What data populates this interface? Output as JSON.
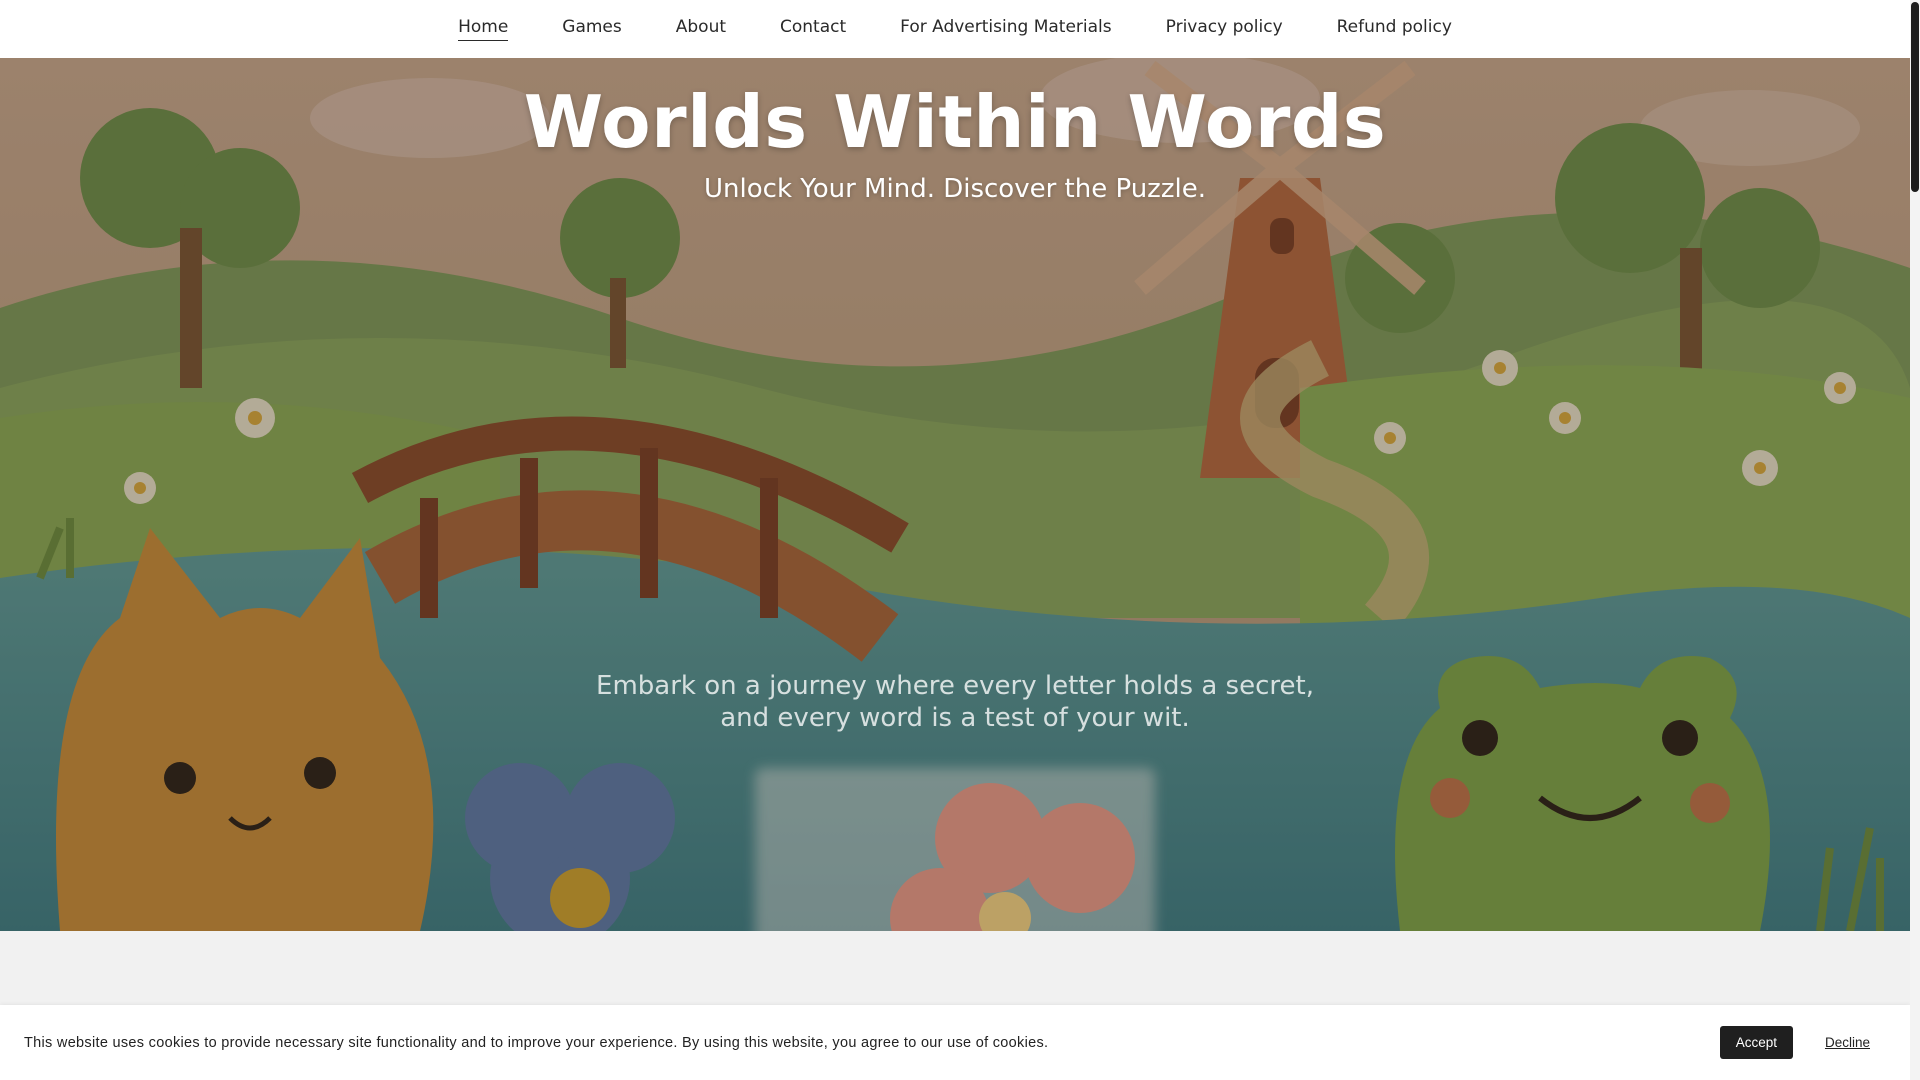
{
  "nav": {
    "items": [
      {
        "label": "Home",
        "active": true
      },
      {
        "label": "Games",
        "active": false
      },
      {
        "label": "About",
        "active": false
      },
      {
        "label": "Contact",
        "active": false
      },
      {
        "label": "For Advertising Materials",
        "active": false
      },
      {
        "label": "Privacy policy",
        "active": false
      },
      {
        "label": "Refund policy",
        "active": false
      }
    ]
  },
  "hero": {
    "title": "Worlds Within Words",
    "subtitle": "Unlock Your Mind. Discover the Puzzle.",
    "body_line1": "Embark on a journey where every letter holds a secret,",
    "body_line2": "and every word is a test of your wit."
  },
  "cookie": {
    "text": "This website uses cookies to provide necessary site functionality and to improve your experience. By using this website, you agree to our use of cookies.",
    "accept_label": "Accept",
    "decline_label": "Decline"
  },
  "colors": {
    "nav_bg": "#ffffff",
    "text_dark": "#2a2a2a",
    "accept_bg": "#1f1f1f",
    "page_bg": "#f2f2f2"
  }
}
